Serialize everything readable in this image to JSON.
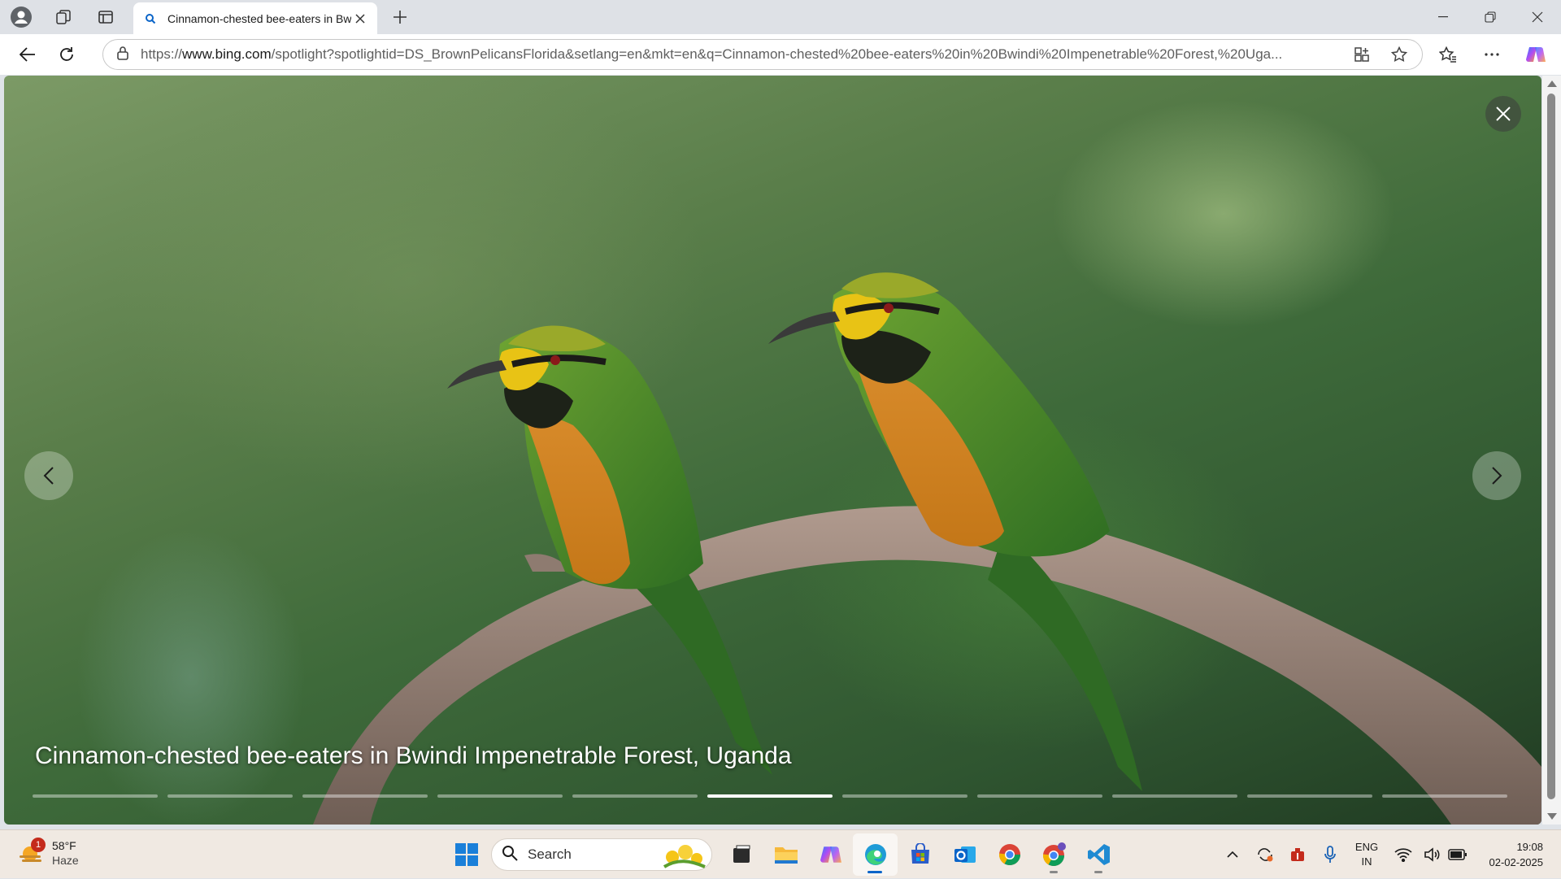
{
  "browser": {
    "tab": {
      "title": "Cinnamon-chested bee-eaters in Bwindi Impenetrable Forest, Uganda"
    },
    "address": {
      "url_prefix": "https://",
      "url_host": "www.bing.com",
      "url_path": "/spotlight?spotlightid=DS_BrownPelicansFlorida&setlang=en&mkt=en&q=Cinnamon-chested%20bee-eaters%20in%20Bwindi%20Impenetrable%20Forest,%20Uga..."
    }
  },
  "viewer": {
    "caption": "Cinnamon-chested bee-eaters in Bwindi Impenetrable Forest, Uganda",
    "progress": {
      "total": 11,
      "active_index": 5
    }
  },
  "taskbar": {
    "weather": {
      "temperature": "58°F",
      "condition": "Haze",
      "badge": "1"
    },
    "search": {
      "placeholder": "Search"
    },
    "tray": {
      "language": "ENG",
      "region": "IN",
      "time": "19:08",
      "date": "02-02-2025"
    }
  },
  "colors": {
    "accent": "#0a64c8",
    "active_segment": "#ffffff"
  }
}
